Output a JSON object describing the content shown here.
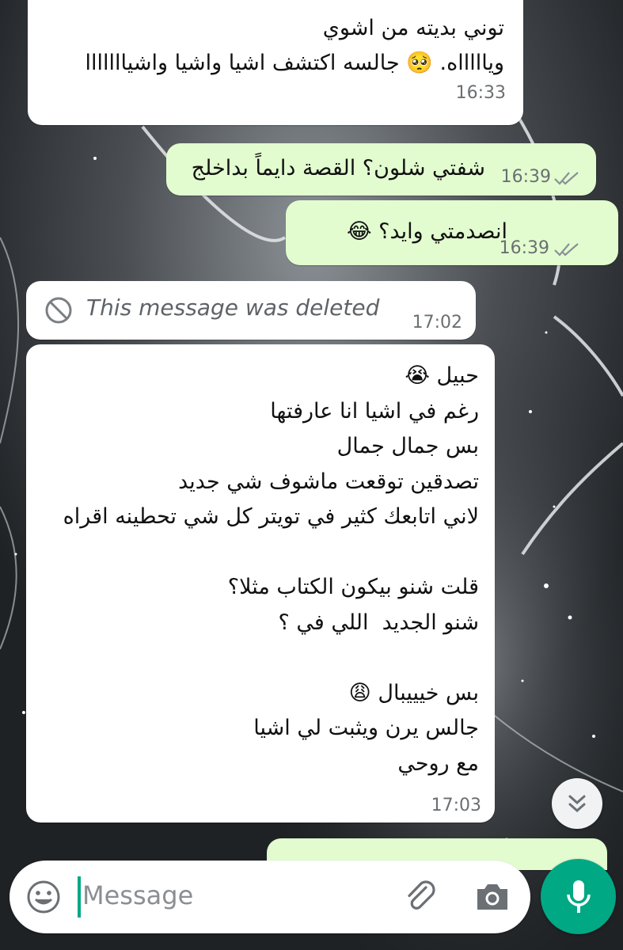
{
  "messages": [
    {
      "direction": "incoming",
      "text": "توني بديته من اشوي\nوياااااه. 🥺 جالسه اكتشف اشيا واشيا واشيااااااا",
      "time": "16:33"
    },
    {
      "direction": "outgoing",
      "text": "شفتي شلون؟ القصة دايماً بداخلج",
      "time": "16:39",
      "status": "read"
    },
    {
      "direction": "outgoing",
      "text": "انصدمتي وايد؟ 😂",
      "time": "16:39",
      "status": "read"
    },
    {
      "direction": "incoming",
      "deleted": true,
      "text": "This message was deleted",
      "time": "17:02"
    },
    {
      "direction": "incoming",
      "text": "حبيل 😭\nرغم في اشيا انا عارفتها\nبس جمال جمال\nتصدقين توقعت ماشوف شي جديد\nلاني اتابعك كثير في تويتر كل شي تحطينه اقراه\n\nقلت شنو بيكون الكتاب مثلا؟\nشنو الجديد  اللي في ؟\n\nبس خيييبال 😩\nجالس يرن ويثبت لي اشيا\nمع روحي",
      "time": "17:03"
    }
  ],
  "composer": {
    "placeholder": "Message"
  },
  "icons": {
    "emoji": "emoji-icon",
    "attach": "paperclip-icon",
    "camera": "camera-icon",
    "mic": "mic-icon",
    "scroll": "chevron-double-down-icon",
    "deleted": "blocked-icon",
    "read": "double-check-icon"
  },
  "colors": {
    "outgoing_bubble": "#e2fcd0",
    "incoming_bubble": "#ffffff",
    "accent": "#00a884",
    "timestamp": "#6b6f72"
  }
}
